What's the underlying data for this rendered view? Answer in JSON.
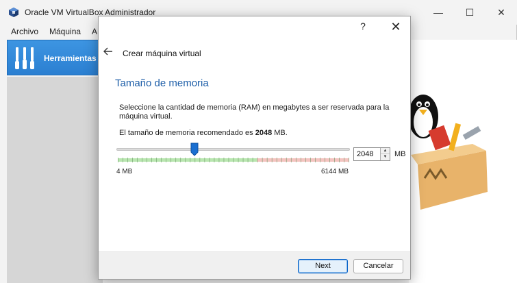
{
  "window": {
    "title": "Oracle VM VirtualBox Administrador",
    "controls": {
      "minimize": "—",
      "maximize": "☐",
      "close": "✕"
    }
  },
  "menubar": {
    "items": [
      "Archivo",
      "Máquina",
      "A"
    ]
  },
  "sidebar": {
    "tools_label": "Herramientas"
  },
  "dialog": {
    "help_label": "?",
    "close_label": "✕",
    "wizard_title": "Crear máquina virtual",
    "heading": "Tamaño de memoria",
    "description": "Seleccione la cantidad de memoria (RAM) en megabytes a ser reservada para la máquina virtual.",
    "recommended_prefix": "El tamaño de memoria recomendado es ",
    "recommended_value": "2048",
    "recommended_suffix": " MB.",
    "slider": {
      "min_label": "4 MB",
      "max_label": "6144 MB",
      "min": 4,
      "max": 6144,
      "value": 2048,
      "safe_limit_fraction": 0.6
    },
    "spinbox": {
      "value": "2048",
      "unit": "MB"
    },
    "buttons": {
      "next_label": "Next",
      "cancel_label": "Cancelar"
    }
  },
  "colors": {
    "accent": "#2b7fd1",
    "heading": "#1d5ea8",
    "scale_green": "#b9e6b0",
    "scale_red": "#f4c4c0"
  },
  "icons": [
    "virtualbox-logo-icon",
    "tools-icon",
    "back-arrow-icon",
    "help-icon",
    "close-icon",
    "spin-up-icon",
    "spin-down-icon",
    "slider-thumb-icon"
  ]
}
